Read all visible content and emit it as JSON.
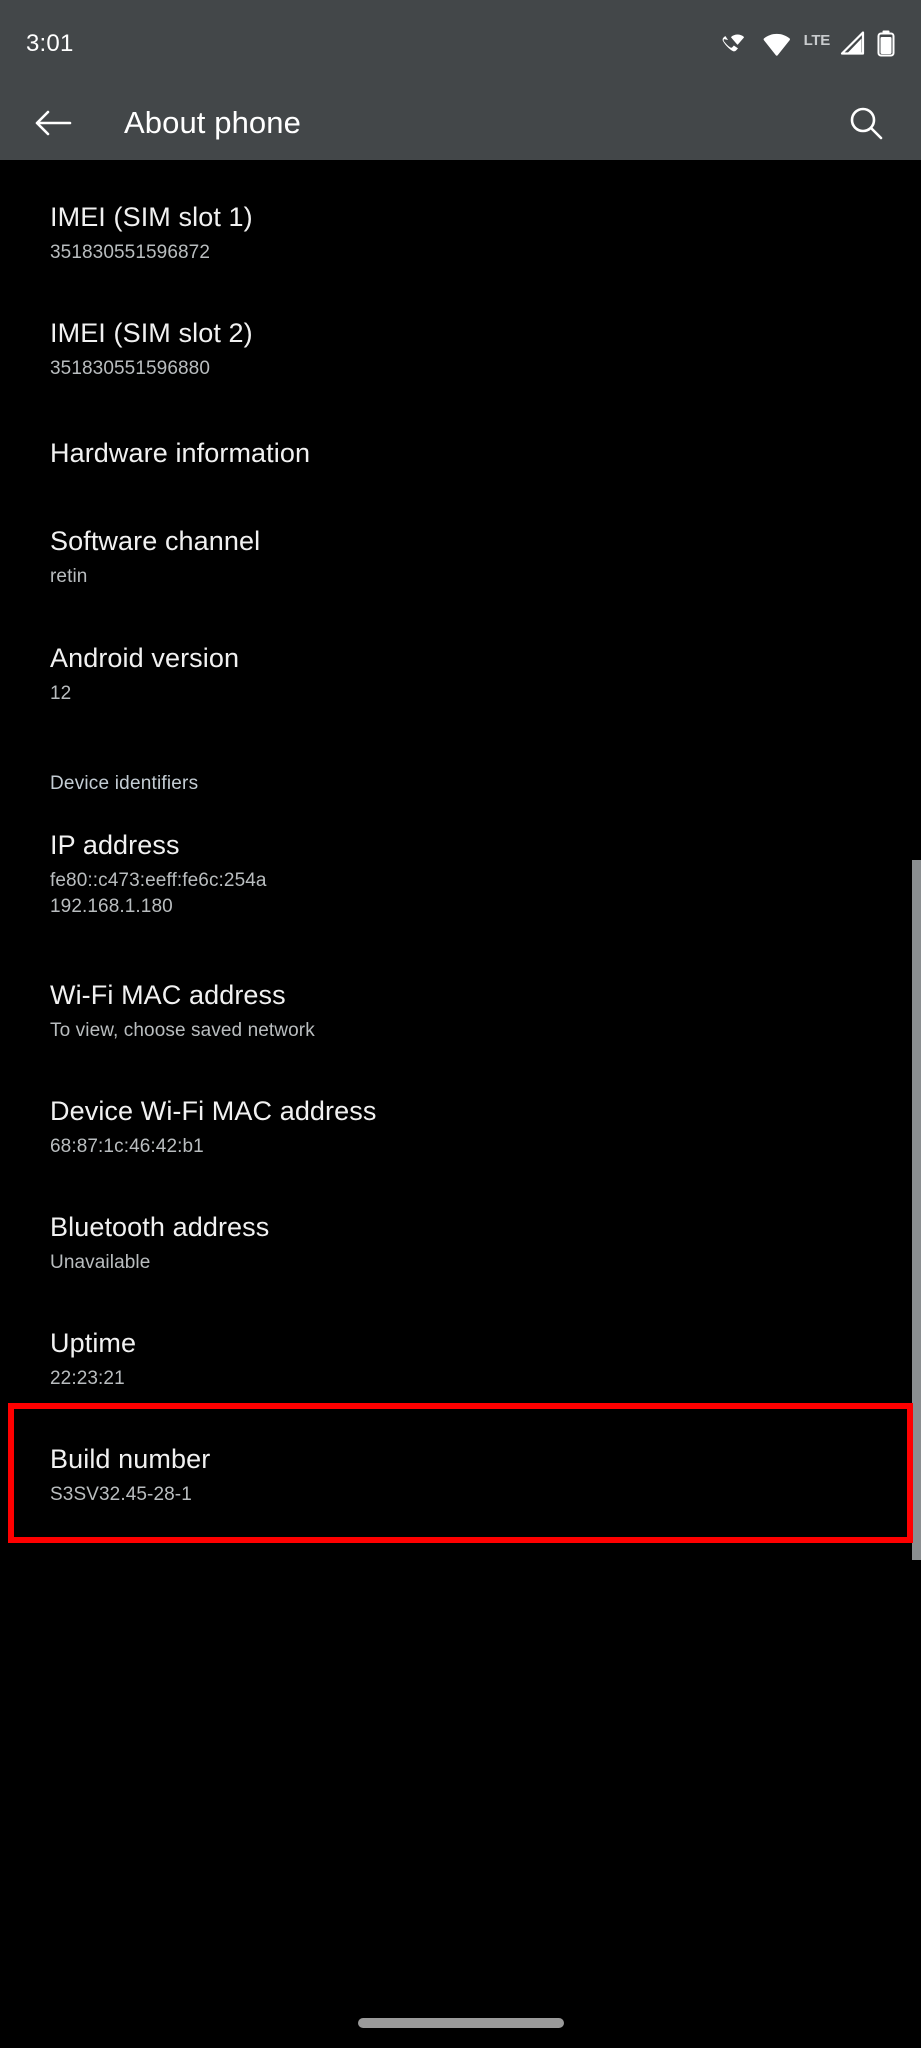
{
  "status_bar": {
    "time": "3:01",
    "network_label": "LTE",
    "icons": [
      "vowifi-call-icon",
      "wifi-icon",
      "lte-label",
      "cellular-signal-icon",
      "battery-icon"
    ]
  },
  "app_bar": {
    "title": "About phone",
    "back_icon": "back-arrow-icon",
    "search_icon": "search-icon"
  },
  "colors": {
    "bar_background": "#434749",
    "page_background": "#000000",
    "title_text": "#f1f1f1",
    "subtitle_text": "#b9bdbf",
    "section_header_text": "#c4cdd4",
    "highlight": "#ff0000",
    "scrollbar": "#8a8e90"
  },
  "list": {
    "items": [
      {
        "title": "IMEI (SIM slot 1)",
        "value": "351830551596872"
      },
      {
        "title": "IMEI (SIM slot 2)",
        "value": "351830551596880"
      },
      {
        "title": "Hardware information",
        "value": ""
      },
      {
        "title": "Software channel",
        "value": "retin"
      },
      {
        "title": "Android version",
        "value": "12"
      }
    ],
    "section_header": "Device identifiers",
    "identifier_items": [
      {
        "title": "IP address",
        "value_line_1": "fe80::c473:eeff:fe6c:254a",
        "value_line_2": "192.168.1.180"
      },
      {
        "title": "Wi-Fi MAC address",
        "value_line_1": "To view, choose saved network",
        "value_line_2": ""
      },
      {
        "title": "Device Wi-Fi MAC address",
        "value_line_1": "68:87:1c:46:42:b1",
        "value_line_2": ""
      },
      {
        "title": "Bluetooth address",
        "value_line_1": "Unavailable",
        "value_line_2": ""
      },
      {
        "title": "Uptime",
        "value_line_1": "22:23:21",
        "value_line_2": ""
      }
    ],
    "highlighted_item": {
      "title": "Build number",
      "value": "S3SV32.45-28-1"
    }
  }
}
